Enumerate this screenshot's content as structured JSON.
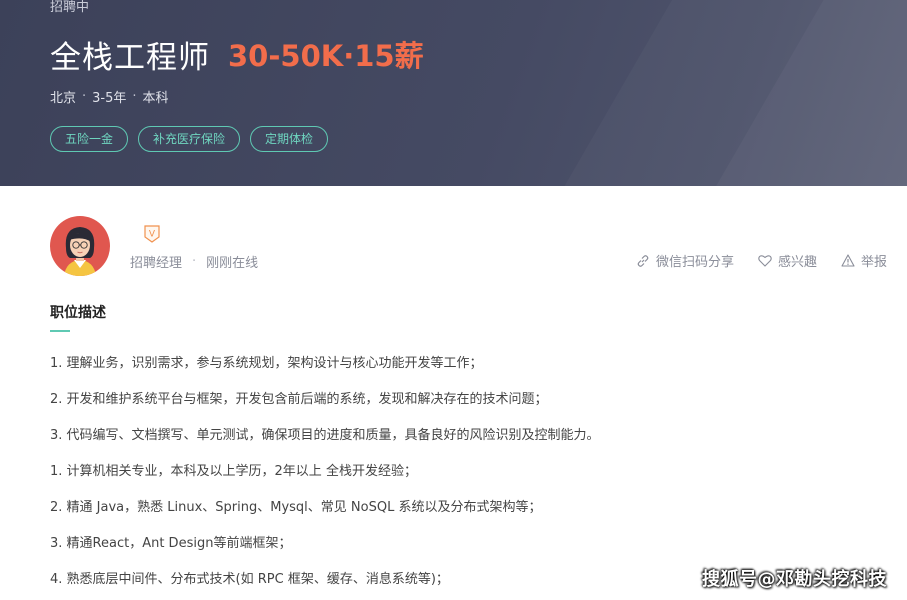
{
  "job": {
    "status": "招聘中",
    "title": "全栈工程师",
    "salary": "30-50K·15薪",
    "meta": {
      "city": "北京",
      "experience": "3-5年",
      "education": "本科",
      "separator": "·"
    },
    "tags": [
      "五险一金",
      "补充医疗保险",
      "定期体检"
    ]
  },
  "recruiter": {
    "badge": "V",
    "role": "招聘经理",
    "dot": "·",
    "online_status": "刚刚在线"
  },
  "actions": {
    "share": "微信扫码分享",
    "interest": "感兴趣",
    "report": "举报"
  },
  "description": {
    "heading": "职位描述",
    "lines": [
      "1. 理解业务，识别需求，参与系统规划，架构设计与核心功能开发等工作；",
      "2. 开发和维护系统平台与框架，开发包含前后端的系统，发现和解决存在的技术问题；",
      "3. 代码编写、文档撰写、单元测试，确保项目的进度和质量，具备良好的风险识别及控制能力。",
      "1. 计算机相关专业，本科及以上学历，2年以上 全栈开发经验；",
      "2. 精通 Java，熟悉 Linux、Spring、Mysql、常见 NoSQL 系统以及分布式架构等；",
      "3. 精通React，Ant Design等前端框架；",
      "4. 熟悉底层中间件、分布式技术(如 RPC 框架、缓存、消息系统等)；"
    ]
  },
  "watermark": "搜狐号@邓勘头挖科技",
  "colors": {
    "banner": "#454a63",
    "salary": "#f26d4b",
    "accent": "#5fc9b3"
  }
}
